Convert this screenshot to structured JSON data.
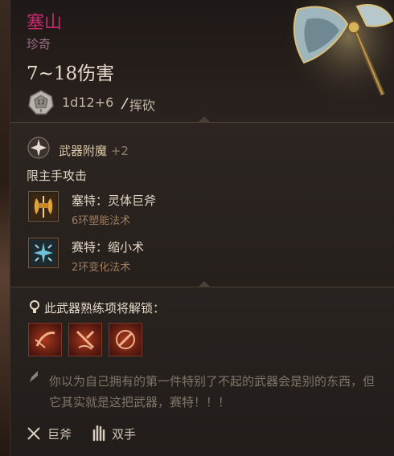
{
  "item": {
    "name": "塞山",
    "rarity": "珍奇",
    "damage": "7~18伤害",
    "die_label": "12",
    "die_sub": "6",
    "roll": "1d12+6",
    "damage_type": "挥砍"
  },
  "enchant": {
    "label": "武器附魔",
    "bonus": "+2",
    "restriction": "限主手攻击"
  },
  "spells": [
    {
      "name": "塞特：灵体巨斧",
      "detail": "6环塑能法术"
    },
    {
      "name": "赛特：缩小术",
      "detail": "2环变化法术"
    }
  ],
  "mastery": {
    "label": "此武器熟练项将解锁："
  },
  "flavor": "你以为自己拥有的第一件特别了不起的武器会是别的东西，但它其实就是这把武器，赛特！！！",
  "footer": {
    "type": "巨斧",
    "hands": "双手"
  },
  "colors": {
    "rarity_name": "#c8296e",
    "gold": "#d9c6a6",
    "flavor": "#7f7468"
  }
}
